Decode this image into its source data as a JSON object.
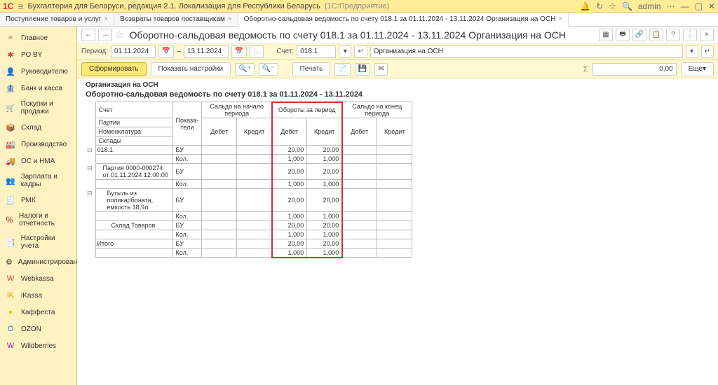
{
  "titlebar": {
    "app_title": "Бухгалтерия для Беларуси, редакция 2.1. Локализация для Республики Беларусь",
    "vendor": "(1С:Предприятие)",
    "user": "admin"
  },
  "tabs": [
    {
      "label": "Поступление товаров и услуг"
    },
    {
      "label": "Возвраты товаров поставщикам"
    },
    {
      "label": "Оборотно-сальдовая ведомость по счету 018.1 за 01.11.2024 - 13.11.2024 Организация на ОСН",
      "active": true
    }
  ],
  "sidebar": {
    "items": [
      {
        "icon": "≡",
        "label": "Главное",
        "color": "#888"
      },
      {
        "icon": "✱",
        "label": "РО BY",
        "color": "#e53935"
      },
      {
        "icon": "👤",
        "label": "Руководителю",
        "color": "#e53935"
      },
      {
        "icon": "🏦",
        "label": "Банк и касса",
        "color": "#b71c1c"
      },
      {
        "icon": "🛒",
        "label": "Покупки и продажи",
        "color": "#333"
      },
      {
        "icon": "📦",
        "label": "Склад",
        "color": "#b71c1c"
      },
      {
        "icon": "🏭",
        "label": "Производство",
        "color": "#333"
      },
      {
        "icon": "🚚",
        "label": "ОС и НМА",
        "color": "#333"
      },
      {
        "icon": "👥",
        "label": "Зарплата и кадры",
        "color": "#333"
      },
      {
        "icon": "🧾",
        "label": "РМК",
        "color": "#b71c1c"
      },
      {
        "icon": "％",
        "label": "Налоги и отчетность",
        "color": "#b71c1c"
      },
      {
        "icon": "📑",
        "label": "Настройки учета",
        "color": "#b71c1c"
      },
      {
        "icon": "⚙",
        "label": "Администрирование",
        "color": "#333"
      },
      {
        "icon": "W",
        "label": "Webkassa",
        "color": "#e53935"
      },
      {
        "icon": "iK",
        "label": "iKassa",
        "color": "#ff9800"
      },
      {
        "icon": "●",
        "label": "Каффеста",
        "color": "#fbc02d"
      },
      {
        "icon": "O",
        "label": "OZON",
        "color": "#1976d2"
      },
      {
        "icon": "W",
        "label": "Wildberries",
        "color": "#8e24aa"
      }
    ]
  },
  "report_header": {
    "title": "Оборотно-сальдовая ведомость по счету 018.1 за 01.11.2024 - 13.11.2024 Организация на ОСН"
  },
  "params": {
    "period_label": "Период:",
    "from": "01.11.2024",
    "dash": "–",
    "to": "13.11.2024",
    "account_label": "Счет:",
    "account": "018.1",
    "org": "Организация на ОСН"
  },
  "actions": {
    "form": "Сформировать",
    "show_settings": "Показать настройки",
    "print": "Печать",
    "sum_value": "0,00",
    "more": "Еще"
  },
  "report": {
    "org": "Организация на ОСН",
    "title": "Оборотно-сальдовая ведомость по счету 018.1 за 01.11.2024 - 13.11.2024",
    "head": {
      "c1": "Счет",
      "c1b": "Партии",
      "c1c": "Номенклатура",
      "c1d": "Склады",
      "c2": "Показа-\nтели",
      "g1": "Сальдо на начало периода",
      "g2": "Обороты за период",
      "g3": "Сальдо на конец периода",
      "sub": {
        "d": "Дебет",
        "k": "Кредит"
      }
    },
    "rows": [
      {
        "label": "018.1",
        "ind": "БУ",
        "d2": "20,00",
        "k2": "20,00"
      },
      {
        "label": "",
        "ind": "Кол.",
        "d2": "1,000",
        "k2": "1,000"
      },
      {
        "label": "Партия 0000-000274 от 01.11.2024 12:00:00",
        "ind": "БУ",
        "d2": "20,00",
        "k2": "20,00"
      },
      {
        "label": "",
        "ind": "Кол.",
        "d2": "1,000",
        "k2": "1,000"
      },
      {
        "label": "Бутыль из поликарбоната, емкость 18,9л",
        "ind": "БУ",
        "d2": "20,00",
        "k2": "20,00"
      },
      {
        "label": "",
        "ind": "Кол.",
        "d2": "1,000",
        "k2": "1,000"
      },
      {
        "label": "Склад Товаров",
        "ind": "БУ",
        "d2": "20,00",
        "k2": "20,00"
      },
      {
        "label": "",
        "ind": "Кол.",
        "d2": "1,000",
        "k2": "1,000"
      },
      {
        "label": "Итого",
        "ind": "БУ",
        "d2": "20,00",
        "k2": "20,00"
      },
      {
        "label": "",
        "ind": "Кол.",
        "d2": "1,000",
        "k2": "1,000"
      }
    ]
  },
  "chart_data": {
    "type": "table",
    "title": "Оборотно-сальдовая ведомость по счету 018.1 за 01.11.2024 - 13.11.2024",
    "columns": [
      "Счет/Партии/Номенклатура/Склады",
      "Показатели",
      "Сальдо нач. Дебет",
      "Сальдо нач. Кредит",
      "Обороты Дебет",
      "Обороты Кредит",
      "Сальдо кон. Дебет",
      "Сальдо кон. Кредит"
    ],
    "rows": [
      [
        "018.1",
        "БУ",
        null,
        null,
        20.0,
        20.0,
        null,
        null
      ],
      [
        "018.1",
        "Кол.",
        null,
        null,
        1.0,
        1.0,
        null,
        null
      ],
      [
        "Партия 0000-000274 от 01.11.2024 12:00:00",
        "БУ",
        null,
        null,
        20.0,
        20.0,
        null,
        null
      ],
      [
        "Партия 0000-000274 от 01.11.2024 12:00:00",
        "Кол.",
        null,
        null,
        1.0,
        1.0,
        null,
        null
      ],
      [
        "Бутыль из поликарбоната, емкость 18,9л",
        "БУ",
        null,
        null,
        20.0,
        20.0,
        null,
        null
      ],
      [
        "Бутыль из поликарбоната, емкость 18,9л",
        "Кол.",
        null,
        null,
        1.0,
        1.0,
        null,
        null
      ],
      [
        "Склад Товаров",
        "БУ",
        null,
        null,
        20.0,
        20.0,
        null,
        null
      ],
      [
        "Склад Товаров",
        "Кол.",
        null,
        null,
        1.0,
        1.0,
        null,
        null
      ],
      [
        "Итого",
        "БУ",
        null,
        null,
        20.0,
        20.0,
        null,
        null
      ],
      [
        "Итого",
        "Кол.",
        null,
        null,
        1.0,
        1.0,
        null,
        null
      ]
    ]
  }
}
